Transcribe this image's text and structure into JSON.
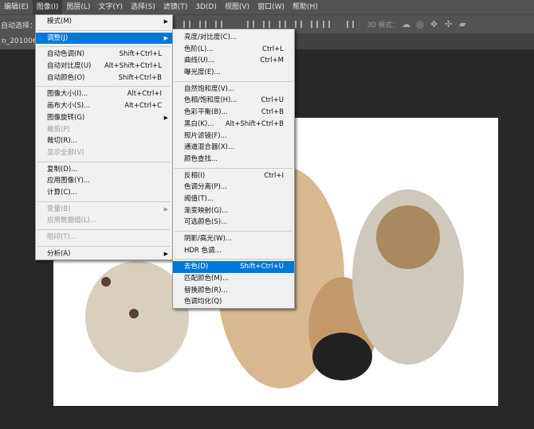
{
  "menubar": [
    "编辑(E)",
    "图像(I)",
    "图层(L)",
    "文字(Y)",
    "选择(S)",
    "滤镜(T)",
    "3D(D)",
    "视图(V)",
    "窗口(W)",
    "帮助(H)"
  ],
  "options": {
    "auto_select": "自动选择：",
    "mode_3d": "3D 模式："
  },
  "document_tab": "n_20100624",
  "image_menu": [
    {
      "label": "模式(M)",
      "submenu": true
    },
    {
      "sep": true
    },
    {
      "label": "调整(J)",
      "submenu": true,
      "highlighted": true
    },
    {
      "sep": true
    },
    {
      "label": "自动色调(N)",
      "shortcut": "Shift+Ctrl+L"
    },
    {
      "label": "自动对比度(U)",
      "shortcut": "Alt+Shift+Ctrl+L"
    },
    {
      "label": "自动颜色(O)",
      "shortcut": "Shift+Ctrl+B"
    },
    {
      "sep": true
    },
    {
      "label": "图像大小(I)...",
      "shortcut": "Alt+Ctrl+I"
    },
    {
      "label": "画布大小(S)...",
      "shortcut": "Alt+Ctrl+C"
    },
    {
      "label": "图像旋转(G)",
      "submenu": true
    },
    {
      "label": "裁剪(P)",
      "disabled": true
    },
    {
      "label": "裁切(R)..."
    },
    {
      "label": "显示全部(V)",
      "disabled": true
    },
    {
      "sep": true
    },
    {
      "label": "复制(D)..."
    },
    {
      "label": "应用图像(Y)..."
    },
    {
      "label": "计算(C)..."
    },
    {
      "sep": true
    },
    {
      "label": "变量(B)",
      "submenu": true,
      "disabled": true
    },
    {
      "label": "应用数据组(L)...",
      "disabled": true
    },
    {
      "sep": true
    },
    {
      "label": "陷印(T)...",
      "disabled": true
    },
    {
      "sep": true
    },
    {
      "label": "分析(A)",
      "submenu": true
    }
  ],
  "adjust_menu": [
    {
      "label": "亮度/对比度(C)..."
    },
    {
      "label": "色阶(L)...",
      "shortcut": "Ctrl+L"
    },
    {
      "label": "曲线(U)...",
      "shortcut": "Ctrl+M"
    },
    {
      "label": "曝光度(E)..."
    },
    {
      "sep": true
    },
    {
      "label": "自然饱和度(V)..."
    },
    {
      "label": "色相/饱和度(H)...",
      "shortcut": "Ctrl+U"
    },
    {
      "label": "色彩平衡(B)...",
      "shortcut": "Ctrl+B"
    },
    {
      "label": "黑白(K)...",
      "shortcut": "Alt+Shift+Ctrl+B"
    },
    {
      "label": "照片滤镜(F)..."
    },
    {
      "label": "通道混合器(X)..."
    },
    {
      "label": "颜色查找..."
    },
    {
      "sep": true
    },
    {
      "label": "反相(I)",
      "shortcut": "Ctrl+I"
    },
    {
      "label": "色调分离(P)..."
    },
    {
      "label": "阈值(T)..."
    },
    {
      "label": "渐变映射(G)..."
    },
    {
      "label": "可选颜色(S)..."
    },
    {
      "sep": true
    },
    {
      "label": "阴影/高光(W)..."
    },
    {
      "label": "HDR 色调..."
    },
    {
      "sep": true
    },
    {
      "label": "去色(D)",
      "shortcut": "Shift+Ctrl+U",
      "highlighted": true
    },
    {
      "label": "匹配颜色(M)..."
    },
    {
      "label": "替换颜色(R)..."
    },
    {
      "label": "色调均化(Q)"
    }
  ],
  "colors": {
    "highlight": "#0078d7",
    "menu_bg": "#f0f0f0",
    "chrome": "#535353"
  }
}
